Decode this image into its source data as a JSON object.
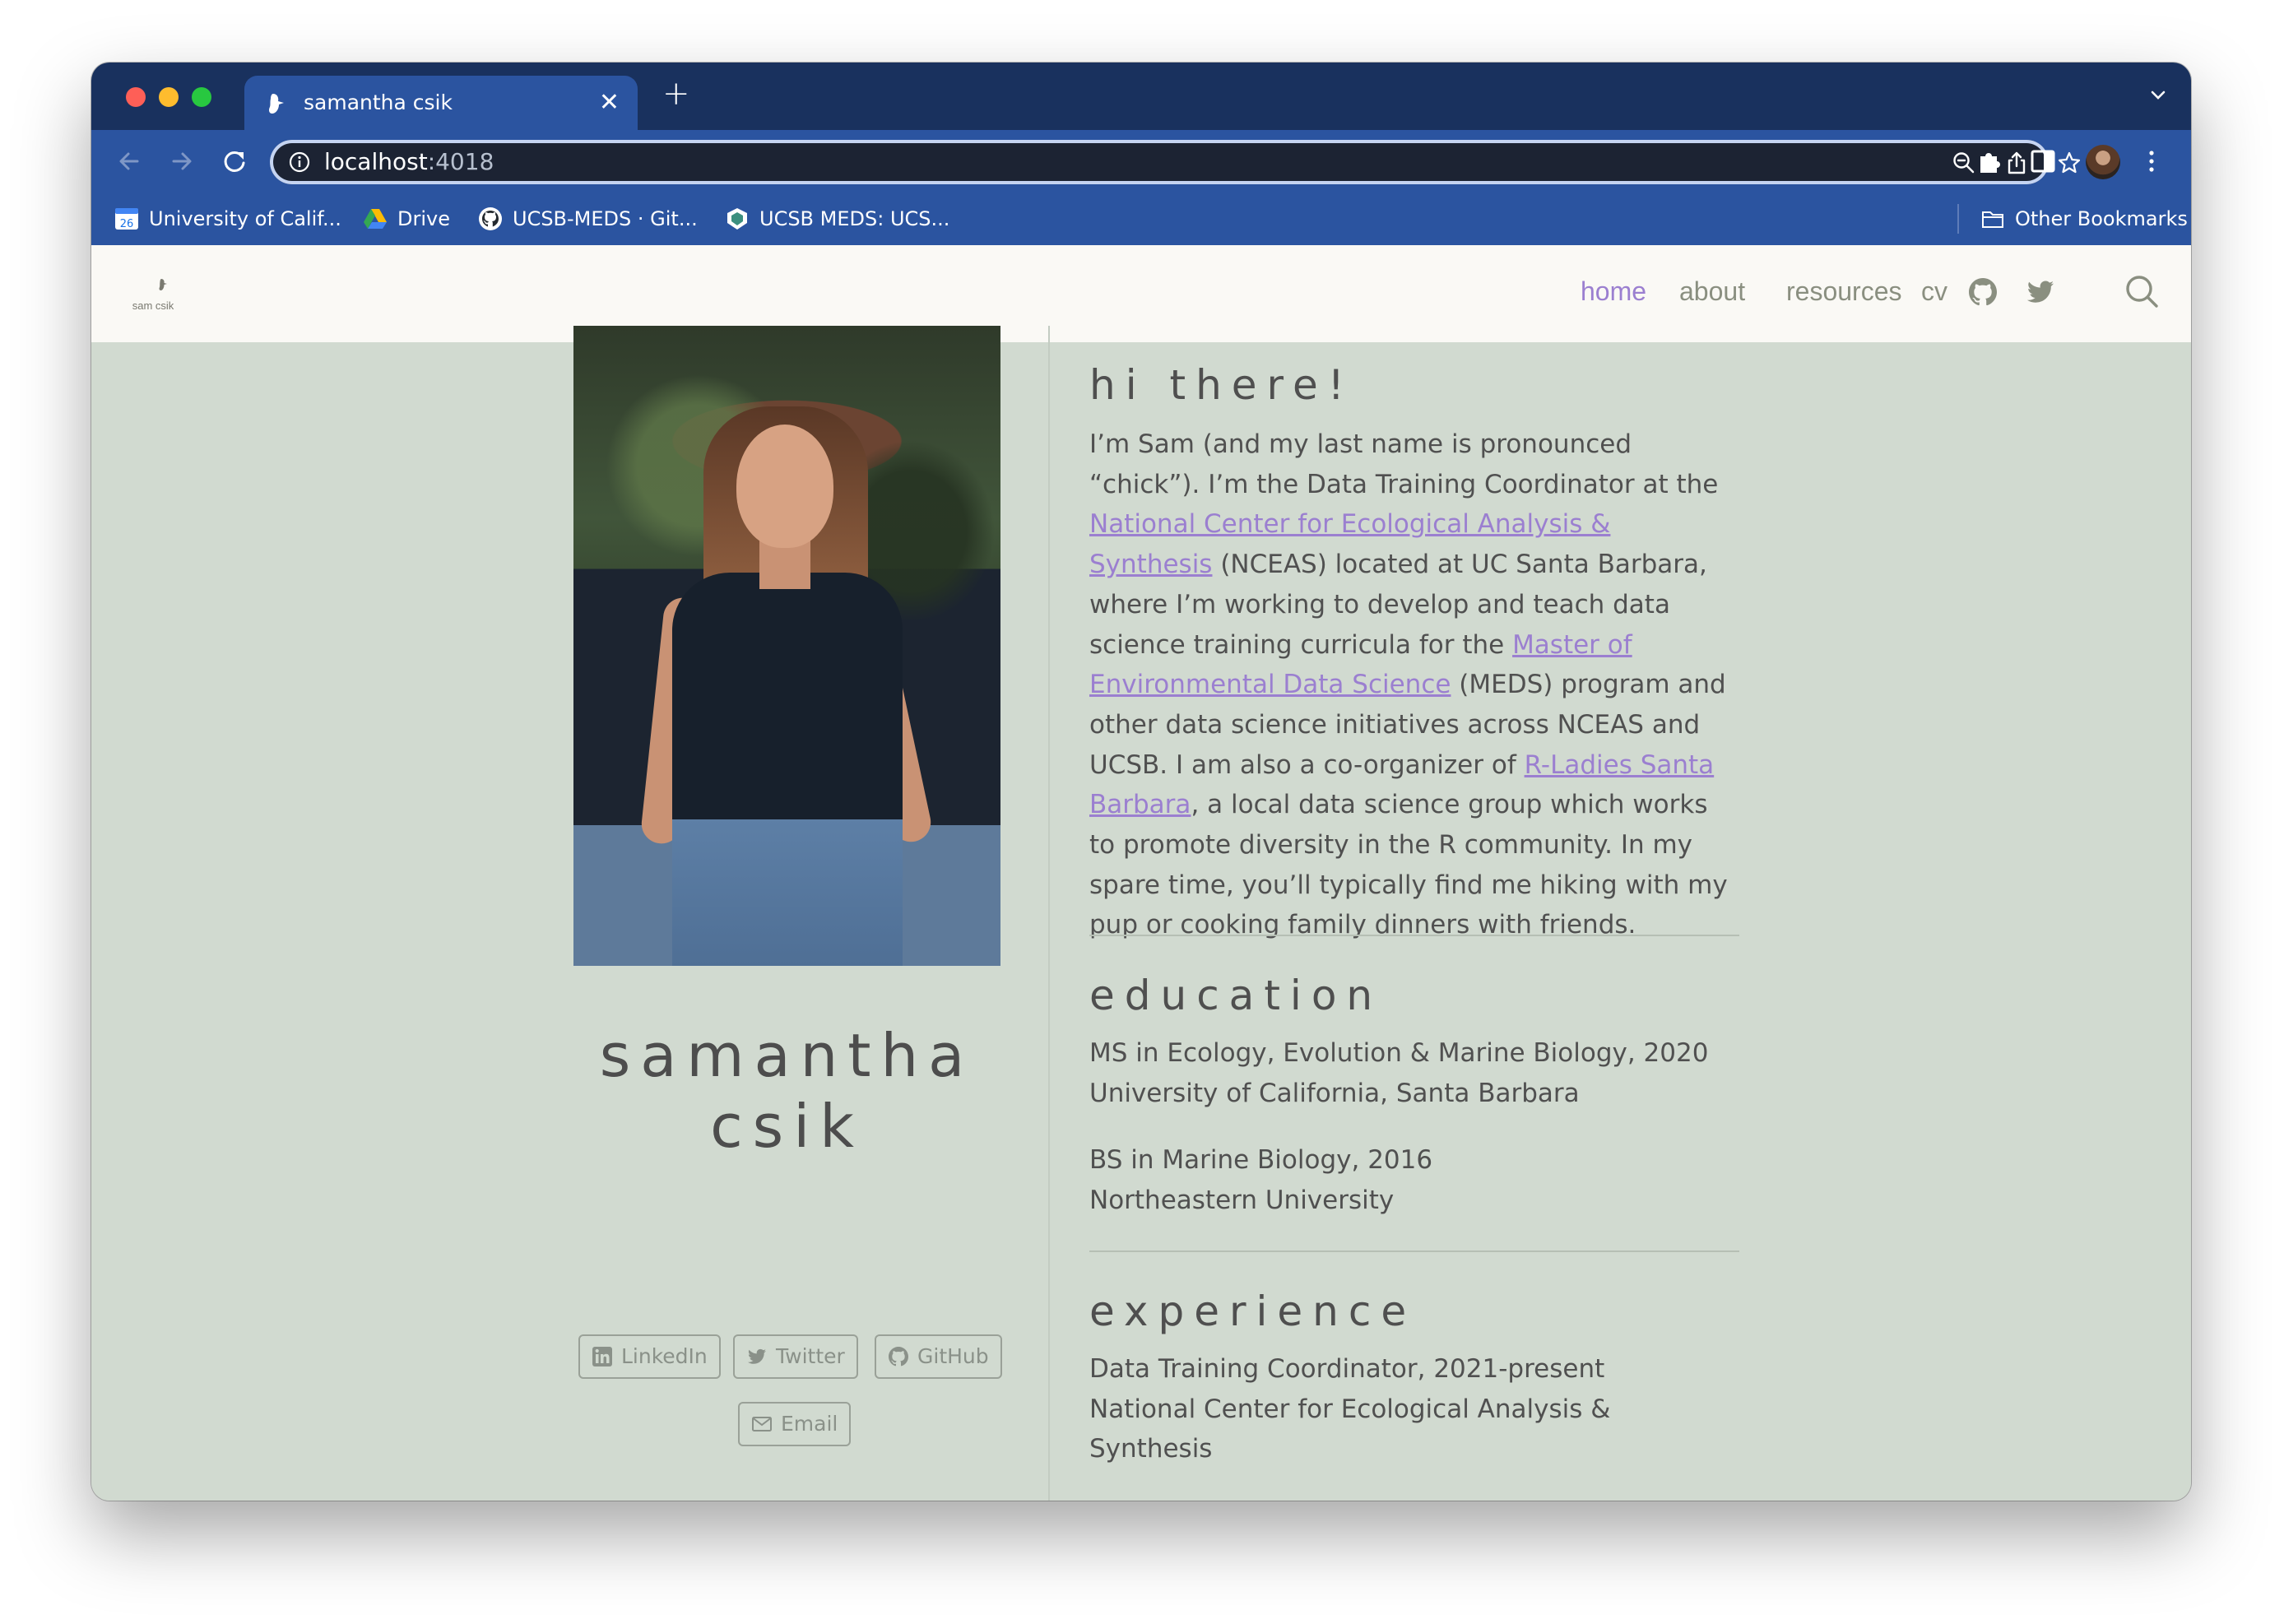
{
  "browser": {
    "tab_title": "samantha csik",
    "url_host": "localhost",
    "url_port": ":4018",
    "bookmarks": [
      {
        "label": "University of Calif...",
        "icon": "calendar-icon",
        "badge": "26"
      },
      {
        "label": "Drive",
        "icon": "drive-icon"
      },
      {
        "label": "UCSB-MEDS · Git...",
        "icon": "github-icon"
      },
      {
        "label": "UCSB MEDS: UCS...",
        "icon": "shield-icon"
      }
    ],
    "other_bookmarks": "Other Bookmarks"
  },
  "site": {
    "logo_text": "sam csik",
    "nav": [
      {
        "label": "home",
        "active": true
      },
      {
        "label": "about"
      },
      {
        "label": "resources"
      },
      {
        "label": "cv"
      }
    ],
    "profile": {
      "name_line1": "samantha",
      "name_line2": "csik",
      "links": [
        "LinkedIn",
        "Twitter",
        "GitHub",
        "Email"
      ]
    },
    "intro": {
      "heading": "hi there!",
      "p1": "I’m Sam (and my last name is pronounced “chick”). I’m the Data Training Coordinator at the ",
      "link1": "National Center for Ecological Analysis & Synthesis",
      "p2": " (NCEAS) located at UC Santa Barbara, where I’m working to develop and teach data science training curricula for the ",
      "link2": "Master of Environmental Data Science",
      "p3": " (MEDS) program and other data science initiatives across NCEAS and UCSB. I am also a co-organizer of ",
      "link3": "R-Ladies Santa Barbara",
      "p4": ", a local data science group which works to promote diversity in the R community. In my spare time, you’ll typically find me hiking with my pup or cooking family dinners with friends."
    },
    "education": {
      "heading": "education",
      "items": [
        {
          "degree": "MS in Ecology, Evolution & Marine Biology, 2020",
          "school": "University of California, Santa Barbara"
        },
        {
          "degree": "BS in Marine Biology, 2016",
          "school": "Northeastern University"
        }
      ]
    },
    "experience": {
      "heading": "experience",
      "items": [
        {
          "role": "Data Training Coordinator, 2021-present",
          "org": "National Center for Ecological Analysis & Synthesis"
        }
      ]
    }
  },
  "colors": {
    "chrome_dark": "#19315e",
    "chrome": "#2b54a0",
    "page_bg": "#d1dad0",
    "nav_bg": "#faf9f5",
    "accent": "#9b7fd0"
  }
}
